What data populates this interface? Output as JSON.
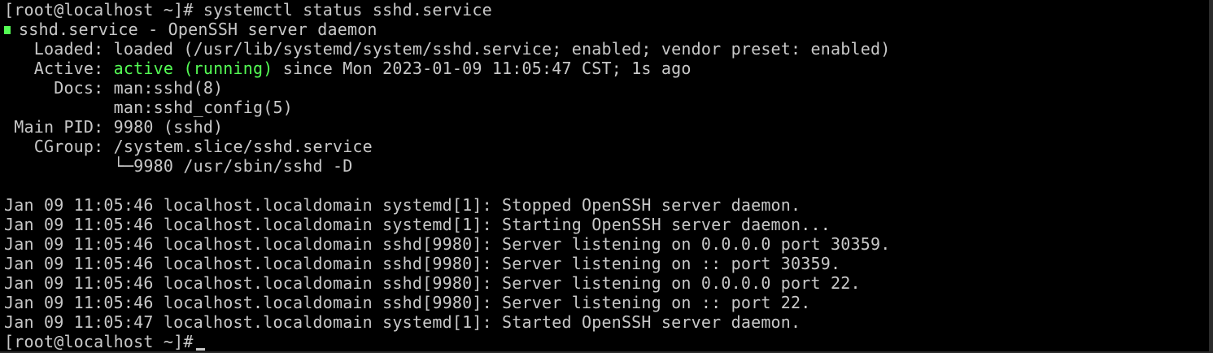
{
  "terminal": {
    "command_line": "[root@localhost ~]# systemctl status sshd.service",
    "unit_header": "sshd.service - OpenSSH server daemon",
    "loaded_line": "   Loaded: loaded (/usr/lib/systemd/system/sshd.service; enabled; vendor preset: enabled)",
    "active_label": "   Active: ",
    "active_state": "active (running)",
    "active_since": " since Mon 2023-01-09 11:05:47 CST; 1s ago",
    "docs_line_1": "     Docs: man:sshd(8)",
    "docs_line_2": "           man:sshd_config(5)",
    "main_pid_line": " Main PID: 9980 (sshd)",
    "cgroup_line": "   CGroup: /system.slice/sshd.service",
    "cgroup_child_line": "           └─9980 /usr/sbin/sshd -D",
    "log_lines": [
      "Jan 09 11:05:46 localhost.localdomain systemd[1]: Stopped OpenSSH server daemon.",
      "Jan 09 11:05:46 localhost.localdomain systemd[1]: Starting OpenSSH server daemon...",
      "Jan 09 11:05:46 localhost.localdomain sshd[9980]: Server listening on 0.0.0.0 port 30359.",
      "Jan 09 11:05:46 localhost.localdomain sshd[9980]: Server listening on :: port 30359.",
      "Jan 09 11:05:46 localhost.localdomain sshd[9980]: Server listening on 0.0.0.0 port 22.",
      "Jan 09 11:05:46 localhost.localdomain sshd[9980]: Server listening on :: port 22.",
      "Jan 09 11:05:47 localhost.localdomain systemd[1]: Started OpenSSH server daemon."
    ],
    "prompt": "[root@localhost ~]#",
    "colors": {
      "background": "#000000",
      "text": "#c8c8c8",
      "active_green": "#54fc54"
    }
  }
}
